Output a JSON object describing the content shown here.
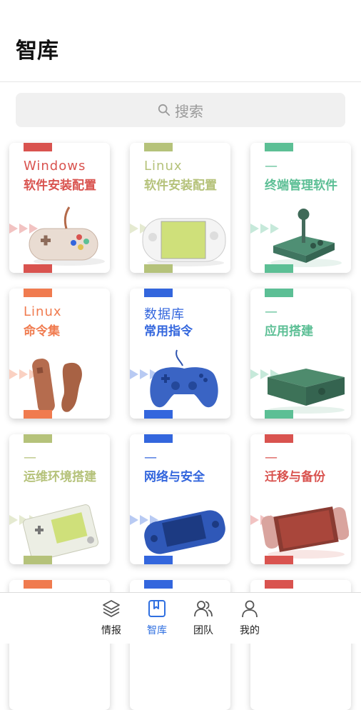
{
  "header": {
    "title": "智库"
  },
  "search": {
    "placeholder": "搜索"
  },
  "cards": [
    {
      "line1": "Windows",
      "line2": "软件安装配置",
      "color": "#d9534f",
      "device": "snes-controller"
    },
    {
      "line1": "Linux",
      "line2": "软件安装配置",
      "color": "#b5c27a",
      "device": "switch-console"
    },
    {
      "line1": "—",
      "line2": "终端管理软件",
      "color": "#5cbf95",
      "device": "arcade-joystick"
    },
    {
      "line1": "Linux",
      "line2": "命令集",
      "color": "#f07b4f",
      "device": "wii-remote"
    },
    {
      "line1": "数据库",
      "line2": "常用指令",
      "color": "#3366dd",
      "device": "gamepad"
    },
    {
      "line1": "—",
      "line2": "应用搭建",
      "color": "#5cbf95",
      "device": "xbox-console"
    },
    {
      "line1": "—",
      "line2": "运维环境搭建",
      "color": "#b5c27a",
      "device": "gameboy"
    },
    {
      "line1": "—",
      "line2": "网络与安全",
      "color": "#3366dd",
      "device": "psp"
    },
    {
      "line1": "—",
      "line2": "迁移与备份",
      "color": "#d9534f",
      "device": "nintendo-switch"
    }
  ],
  "tabbar": {
    "items": [
      {
        "label": "情报",
        "icon": "layers-icon",
        "active": false
      },
      {
        "label": "智库",
        "icon": "bookmark-icon",
        "active": true
      },
      {
        "label": "团队",
        "icon": "team-icon",
        "active": false
      },
      {
        "label": "我的",
        "icon": "user-icon",
        "active": false
      }
    ],
    "active_color": "#2f6fe0"
  }
}
